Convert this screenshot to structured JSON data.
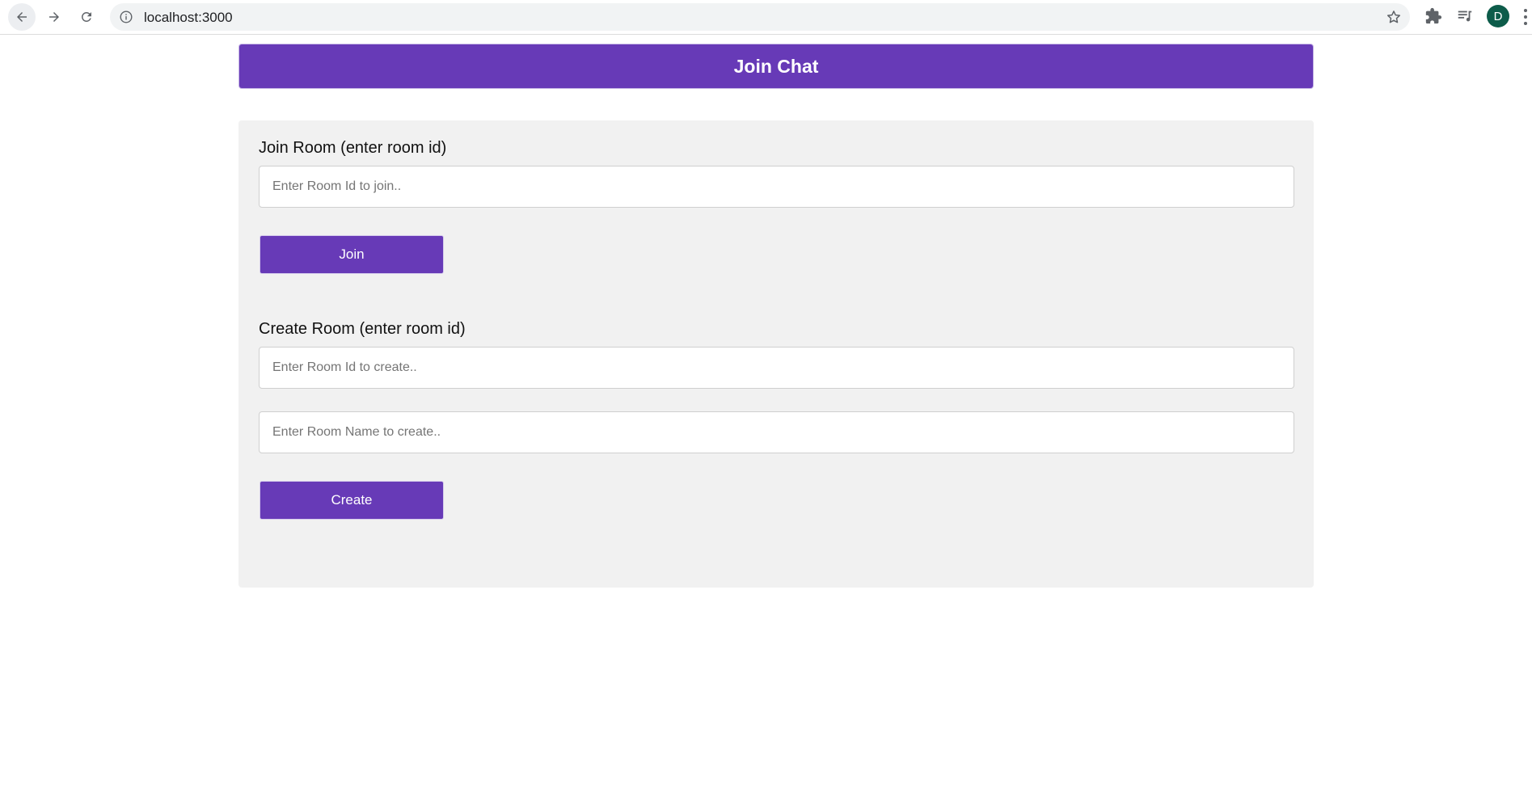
{
  "browser": {
    "url": "localhost:3000",
    "profile_initial": "D",
    "icons": {
      "back": "arrow-left-icon",
      "forward": "arrow-right-icon",
      "reload": "reload-icon",
      "site_info": "info-icon",
      "bookmark": "star-icon",
      "extensions": "puzzle-icon",
      "media": "playlist-icon",
      "menu": "kebab-menu-icon"
    }
  },
  "header": {
    "title": "Join Chat"
  },
  "join_section": {
    "label": "Join Room (enter room id)",
    "room_id_placeholder": "Enter Room Id to join..",
    "room_id_value": "",
    "button_label": "Join"
  },
  "create_section": {
    "label": "Create Room (enter room id)",
    "room_id_placeholder": "Enter Room Id to create..",
    "room_id_value": "",
    "room_name_placeholder": "Enter Room Name to create..",
    "room_name_value": "",
    "button_label": "Create"
  },
  "colors": {
    "accent": "#673ab7",
    "panel_background": "#f1f1f1",
    "avatar_background": "#0d5c4a"
  }
}
